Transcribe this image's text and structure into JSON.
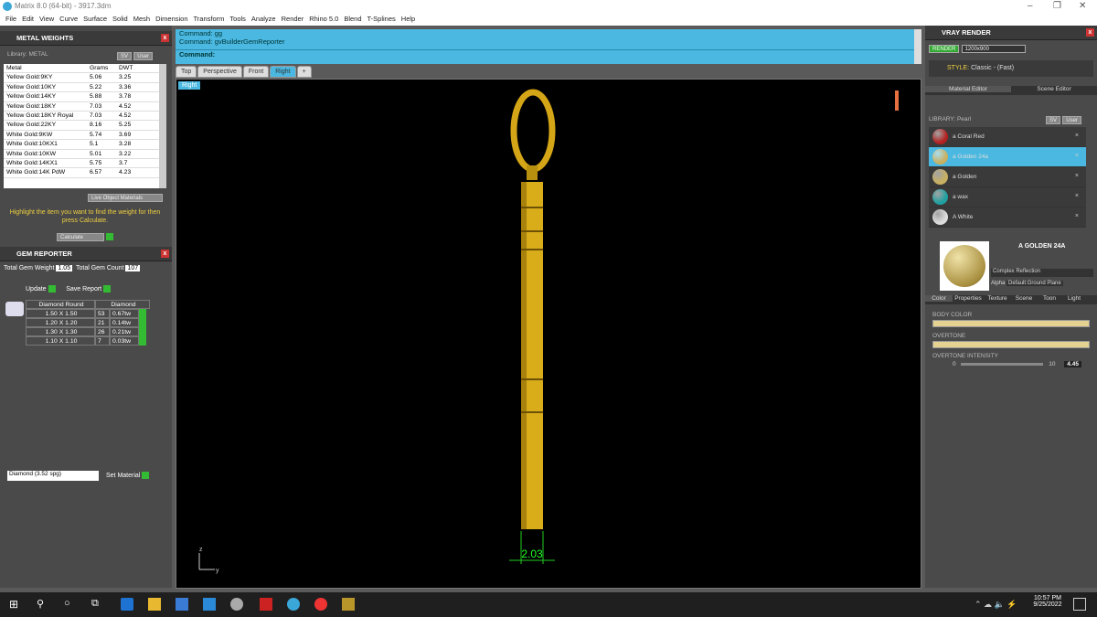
{
  "window": {
    "title": "Matrix 8.0 (64-bit) - 3917.3dm"
  },
  "menu": [
    "File",
    "Edit",
    "View",
    "Curve",
    "Surface",
    "Solid",
    "Mesh",
    "Dimension",
    "Transform",
    "Tools",
    "Analyze",
    "Render",
    "Rhino 5.0",
    "Blend",
    "T-Splines",
    "Help"
  ],
  "metal": {
    "title": "METAL WEIGHTS",
    "library": "Library: METAL",
    "sv": "SV",
    "user": "User",
    "headers": [
      "Metal",
      "Grams",
      "DWT"
    ],
    "rows": [
      [
        "Yellow Gold:9KY",
        "5.06",
        "3.25"
      ],
      [
        "Yellow Gold:10KY",
        "5.22",
        "3.36"
      ],
      [
        "Yellow Gold:14KY",
        "5.88",
        "3.78"
      ],
      [
        "Yellow Gold:18KY",
        "7.03",
        "4.52"
      ],
      [
        "Yellow Gold:18KY Royal",
        "7.03",
        "4.52"
      ],
      [
        "Yellow Gold:22KY",
        "8.16",
        "5.25"
      ],
      [
        "White Gold:9KW",
        "5.74",
        "3.69"
      ],
      [
        "White Gold:10KX1",
        "5.1",
        "3.28"
      ],
      [
        "White Gold:10KW",
        "5.01",
        "3.22"
      ],
      [
        "White Gold:14KX1",
        "5.75",
        "3.7"
      ],
      [
        "White Gold:14K PdW",
        "6.57",
        "4.23"
      ]
    ],
    "live": "Live Object Materials",
    "hint": "Highlight the item you want to find the weight for then press Calculate.",
    "calc": "Calculate"
  },
  "gem": {
    "title": "GEM REPORTER",
    "total_weight_label": "Total Gem Weight",
    "total_weight": "1.05",
    "total_count_label": "Total Gem Count",
    "total_count": "107",
    "update": "Update",
    "save": "Save Report",
    "headers": [
      "Diamond Round",
      "Diamond"
    ],
    "rows": [
      [
        "1.50 X 1.50",
        "53",
        "0.67tw"
      ],
      [
        "1.20 X 1.20",
        "21",
        "0.14tw"
      ],
      [
        "1.30 X 1.30",
        "26",
        "0.21tw"
      ],
      [
        "1.10 X 1.10",
        "7",
        "0.03tw"
      ]
    ],
    "material": "Diamond   (3.52 spg)",
    "set_material": "Set Material"
  },
  "command": {
    "line1": "Command: gg",
    "line2": "Command: gvBuilderGemReporter",
    "prompt": "Command:"
  },
  "tabs": [
    "Top",
    "Perspective",
    "Front",
    "Right"
  ],
  "viewport": {
    "label": "Right",
    "dimension": "2.03",
    "axis_z": "z",
    "axis_y": "y"
  },
  "vray": {
    "title": "VRAY RENDER",
    "render": "RENDER",
    "resolution": "1200x900",
    "style_label": "STYLE:",
    "style": "Classic - (Fast)",
    "tab_material": "Material Editor",
    "tab_scene": "Scene Editor",
    "library": "LIBRARY: Pearl",
    "sv": "SV",
    "user": "User",
    "materials": [
      {
        "name": "a Coral Red",
        "color": "#b22222"
      },
      {
        "name": "a Golden 24a",
        "color": "#c8b060"
      },
      {
        "name": "a Golden",
        "color": "#c8b060"
      },
      {
        "name": "a wax",
        "color": "#20a0a0"
      },
      {
        "name": "A White",
        "color": "#dddddd"
      }
    ],
    "selected_name": "A GOLDEN 24A",
    "reflection": "Complex Reflection",
    "alpha": "Alpha",
    "ground": "Default:Ground Plane",
    "subtabs": [
      "Color",
      "Properties",
      "Texture",
      "Scene",
      "Toon",
      "Light"
    ],
    "body_color": "BODY COLOR",
    "overtone": "OVERTONE",
    "intensity_label": "OVERTONE INTENSITY",
    "intensity_min": "0",
    "intensity_max": "10",
    "intensity_value": "4.45"
  },
  "taskbar": {
    "time": "10:57 PM",
    "date": "9/25/2022"
  },
  "colors": {
    "accent": "#4ab8e0",
    "gold": "#d4a516",
    "green": "#33cc33"
  }
}
